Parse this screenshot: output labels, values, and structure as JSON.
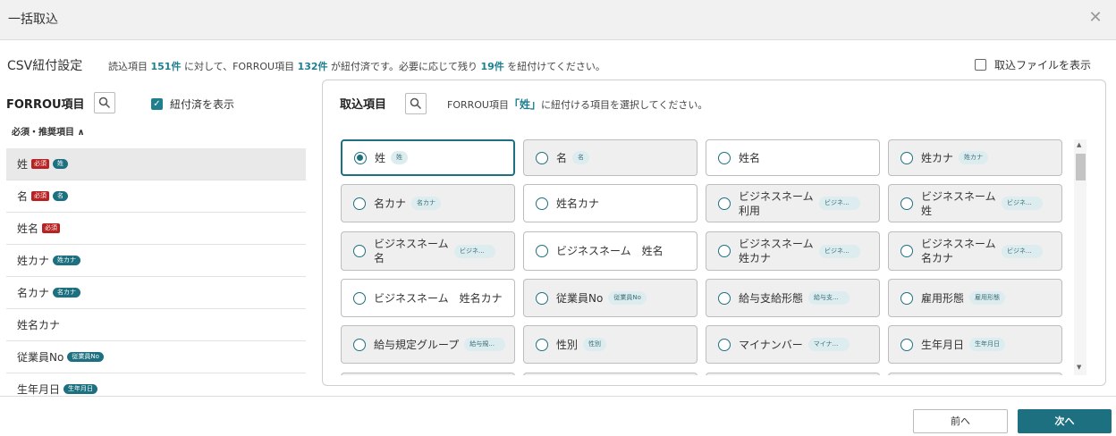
{
  "dialog": {
    "title": "一括取込"
  },
  "summary": {
    "label": "CSV紐付設定",
    "t1": "読込項目",
    "read_count": "151件",
    "t2": "に対して、FORROU項目",
    "linked_count": "132件",
    "t3": "が紐付済です。必要に応じて残り",
    "remaining_count": "19件",
    "t4": "を紐付けてください。",
    "show_file_label": "取込ファイルを表示"
  },
  "left": {
    "title": "FORROU項目",
    "show_linked_label": "紐付済を表示",
    "required_toggle": "必須・推奨項目 ∧",
    "required_tag": "必須",
    "items": [
      {
        "label": "姓",
        "req": true,
        "ref": "姓"
      },
      {
        "label": "名",
        "req": true,
        "ref": "名"
      },
      {
        "label": "姓名",
        "req": true,
        "ref": ""
      },
      {
        "label": "姓カナ",
        "req": false,
        "ref": "姓カナ"
      },
      {
        "label": "名カナ",
        "req": false,
        "ref": "名カナ"
      },
      {
        "label": "姓名カナ",
        "req": false,
        "ref": ""
      },
      {
        "label": "従業員No",
        "req": false,
        "ref": "従業員No"
      },
      {
        "label": "生年月日",
        "req": false,
        "ref": "生年月日"
      }
    ]
  },
  "panel": {
    "title": "取込項目",
    "hint_pre": "FORROU項目",
    "hint_target": "「姓」",
    "hint_post": "に紐付ける項目を選択してください。",
    "options": [
      {
        "label": "姓",
        "chip": "姓",
        "selected": true
      },
      {
        "label": "名",
        "chip": "名"
      },
      {
        "label": "姓名",
        "chip": ""
      },
      {
        "label": "姓カナ",
        "chip": "姓カナ"
      },
      {
        "label": "名カナ",
        "chip": "名カナ"
      },
      {
        "label": "姓名カナ",
        "chip": ""
      },
      {
        "label": "ビジネスネーム利用",
        "chip": "ビジネ..."
      },
      {
        "label": "ビジネスネーム　姓",
        "chip": "ビジネ..."
      },
      {
        "label": "ビジネスネーム　名",
        "chip": "ビジネ..."
      },
      {
        "label": "ビジネスネーム　姓名",
        "chip": ""
      },
      {
        "label": "ビジネスネーム　姓カナ",
        "chip": "ビジネ..."
      },
      {
        "label": "ビジネスネーム　名カナ",
        "chip": "ビジネ..."
      },
      {
        "label": "ビジネスネーム　姓名カナ",
        "chip": ""
      },
      {
        "label": "従業員No",
        "chip": "従業員No"
      },
      {
        "label": "給与支給形態",
        "chip": "給与支..."
      },
      {
        "label": "雇用形態",
        "chip": "雇用形態"
      },
      {
        "label": "給与規定グループ",
        "chip": "給与規..."
      },
      {
        "label": "性別",
        "chip": "性別"
      },
      {
        "label": "マイナンバー",
        "chip": "マイナ..."
      },
      {
        "label": "生年月日",
        "chip": "生年月日"
      }
    ]
  },
  "footer": {
    "prev_label": "前へ",
    "next_label": "次へ"
  },
  "colors": {
    "accent": "#1d7080",
    "required": "#b82222"
  }
}
